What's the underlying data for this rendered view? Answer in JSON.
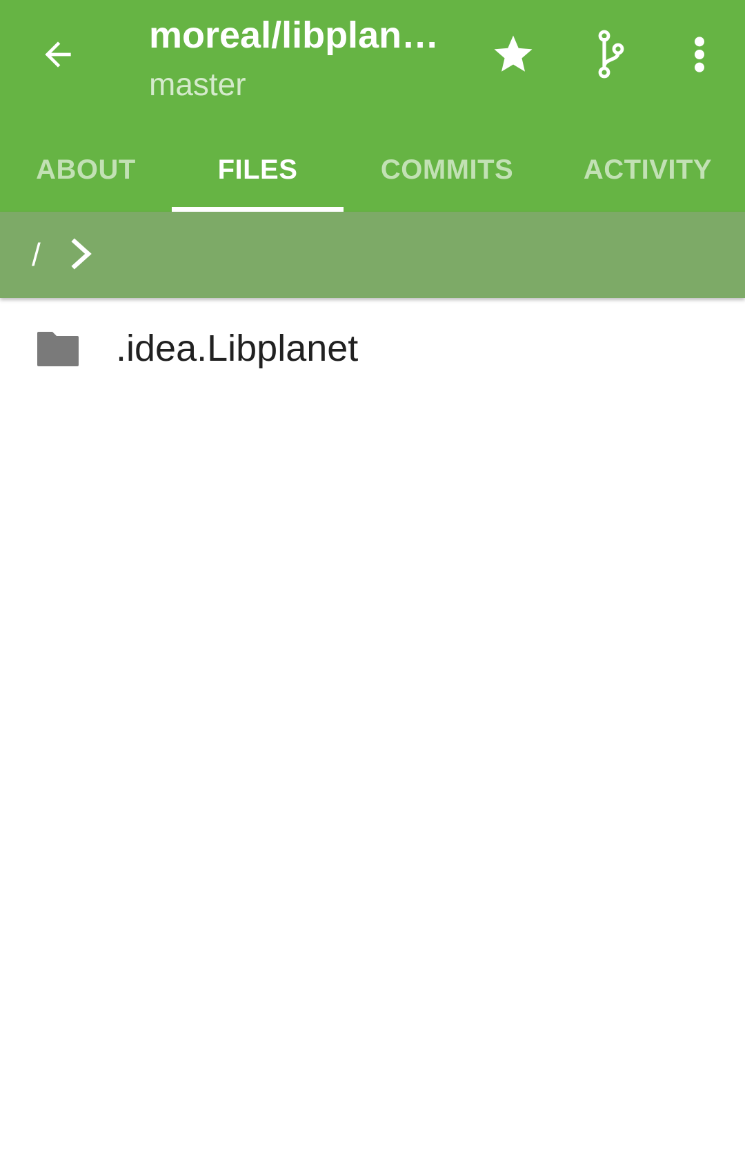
{
  "app_bar": {
    "title": "moreal/libplan…",
    "subtitle": "master",
    "background_color": "#66b444",
    "back_icon": "arrow-left-icon",
    "actions": [
      {
        "icon": "star-icon"
      },
      {
        "icon": "git-branch-icon"
      },
      {
        "icon": "more-vertical-icon"
      }
    ]
  },
  "tabs": [
    {
      "label": "ABOUT",
      "active": false
    },
    {
      "label": "FILES",
      "active": true
    },
    {
      "label": "COMMITS",
      "active": false
    },
    {
      "label": "ACTIVITY",
      "active": false
    }
  ],
  "breadcrumb": {
    "root": "/",
    "separator_icon": "chevron-right-icon",
    "background_color": "#7daa67"
  },
  "files": [
    {
      "name": ".idea.Libplanet",
      "type": "folder",
      "icon": "folder-icon"
    }
  ]
}
